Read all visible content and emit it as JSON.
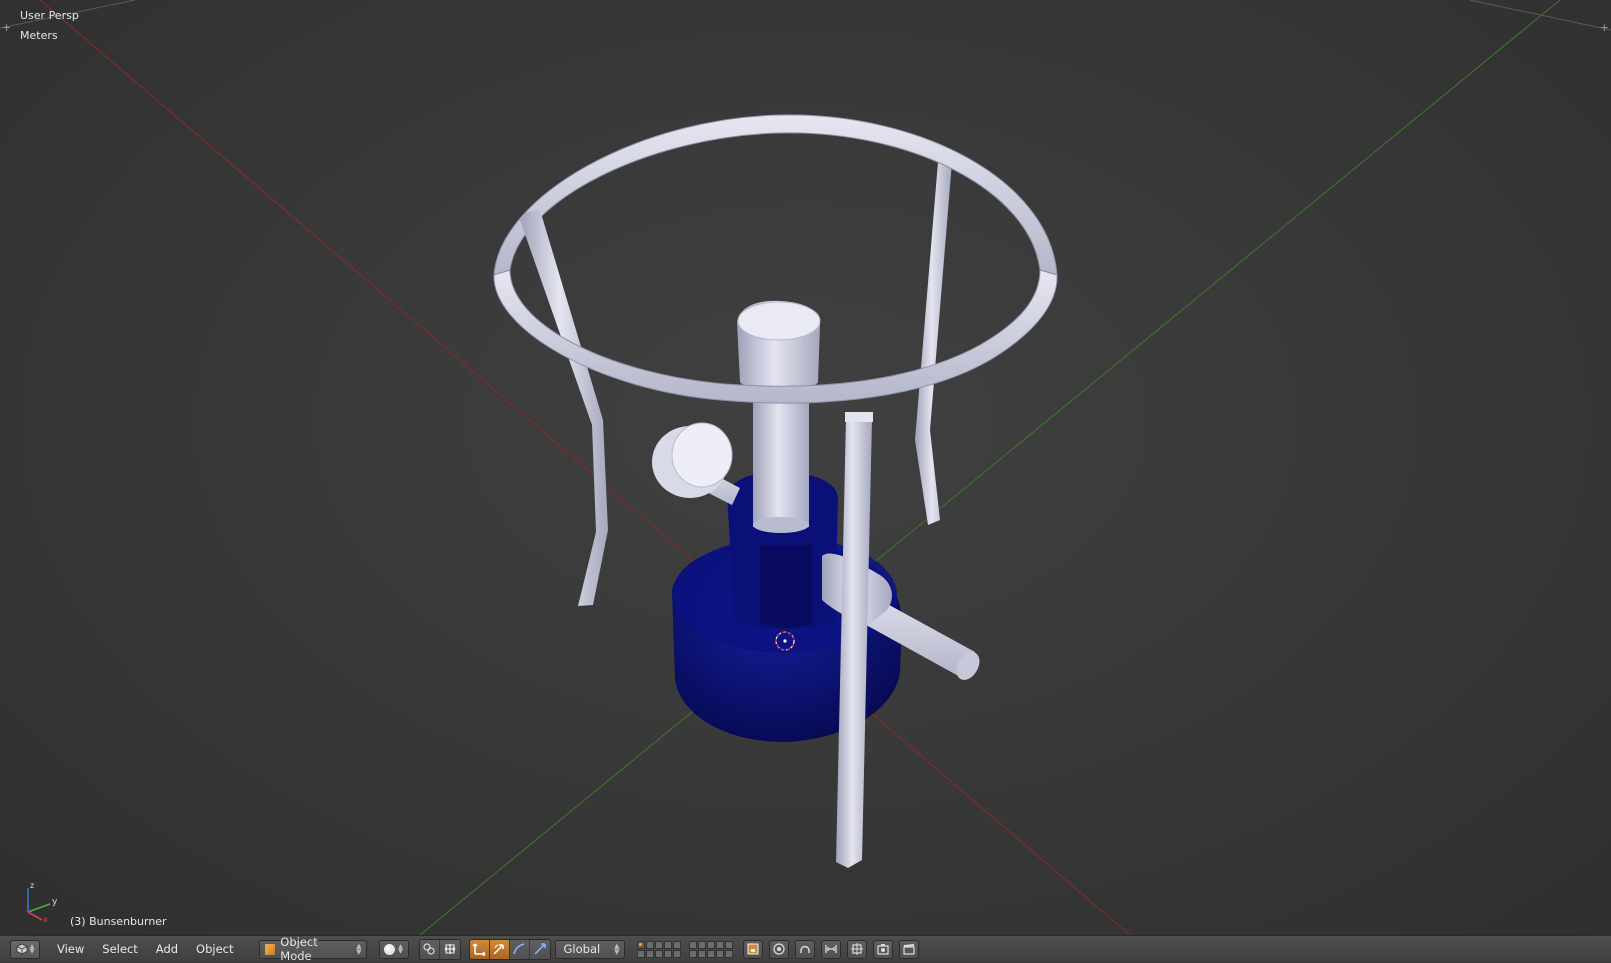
{
  "viewport": {
    "view_name": "User Persp",
    "units": "Meters",
    "active_object": "(3) Bunsenburner",
    "object_color": "#0c1280",
    "metal_color": "#c8cadb"
  },
  "header": {
    "menus": [
      "View",
      "Select",
      "Add",
      "Object"
    ],
    "mode": "Object Mode",
    "orientation": "Global",
    "icons": [
      "editor-type-icon",
      "viewport-shading-icon",
      "pivot-icon",
      "manipulator-icon",
      "translate-icon",
      "rotate-icon",
      "scale-icon",
      "layers-icon",
      "lock-camera-icon",
      "proportional-edit-icon",
      "snap-icon",
      "snap-target-icon",
      "render-still-icon",
      "render-animation-icon"
    ]
  },
  "colors": {
    "accent_orange": "#d08a3c",
    "axis_x_red": "#8a2a2a",
    "axis_y_green": "#3c7a2a"
  }
}
